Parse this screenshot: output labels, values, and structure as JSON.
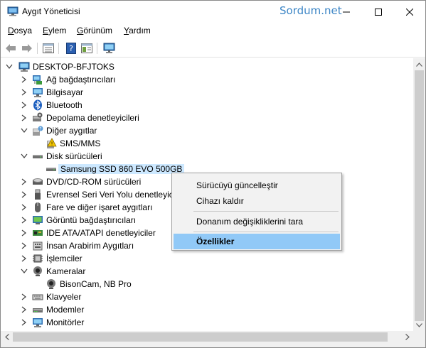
{
  "window": {
    "title": "Aygıt Yöneticisi",
    "watermark": "Sordum.net"
  },
  "menu": [
    {
      "label": "Dosya",
      "key": "D",
      "rest": "osya"
    },
    {
      "label": "Eylem",
      "key": "E",
      "rest": "ylem"
    },
    {
      "label": "Görünüm",
      "key": "G",
      "rest": "örünüm"
    },
    {
      "label": "Yardım",
      "key": "Y",
      "rest": "ardım"
    }
  ],
  "toolbar": {
    "icons": [
      "back-arrow-icon",
      "forward-arrow-icon",
      "properties-grid-icon",
      "help-icon",
      "details-panel-icon",
      "monitor-scan-icon"
    ]
  },
  "tree": {
    "root": "DESKTOP-BFJTOKS",
    "nodes": [
      {
        "label": "Ağ bağdaştırıcıları",
        "icon": "network-adapter-icon",
        "state": "collapsed",
        "level": 1
      },
      {
        "label": "Bilgisayar",
        "icon": "computer-icon",
        "state": "collapsed",
        "level": 1
      },
      {
        "label": "Bluetooth",
        "icon": "bluetooth-icon",
        "state": "collapsed",
        "level": 1
      },
      {
        "label": "Depolama denetleyicileri",
        "icon": "storage-controller-icon",
        "state": "collapsed",
        "level": 1
      },
      {
        "label": "Diğer aygıtlar",
        "icon": "other-devices-icon",
        "state": "expanded",
        "level": 1
      },
      {
        "label": "SMS/MMS",
        "icon": "unknown-device-icon",
        "state": "leaf",
        "level": 2
      },
      {
        "label": "Disk sürücüleri",
        "icon": "disk-drive-icon",
        "state": "expanded",
        "level": 1
      },
      {
        "label": "Samsung SSD 860 EVO 500GB",
        "icon": "disk-drive-icon",
        "state": "leaf",
        "level": 2,
        "selected": true
      },
      {
        "label": "DVD/CD-ROM sürücüleri",
        "icon": "dvd-drive-icon",
        "state": "collapsed",
        "level": 1
      },
      {
        "label": "Evrensel Seri Veri Yolu denetleyici",
        "icon": "usb-icon",
        "state": "collapsed",
        "level": 1
      },
      {
        "label": "Fare ve diğer işaret aygıtları",
        "icon": "mouse-icon",
        "state": "collapsed",
        "level": 1
      },
      {
        "label": "Görüntü bağdaştırıcıları",
        "icon": "display-adapter-icon",
        "state": "collapsed",
        "level": 1
      },
      {
        "label": "IDE ATA/ATAPI denetleyiciler",
        "icon": "ide-controller-icon",
        "state": "collapsed",
        "level": 1
      },
      {
        "label": "İnsan Arabirim Aygıtları",
        "icon": "hid-icon",
        "state": "collapsed",
        "level": 1
      },
      {
        "label": "İşlemciler",
        "icon": "processor-icon",
        "state": "collapsed",
        "level": 1
      },
      {
        "label": "Kameralar",
        "icon": "camera-icon",
        "state": "expanded",
        "level": 1
      },
      {
        "label": "BisonCam, NB Pro",
        "icon": "camera-icon",
        "state": "leaf",
        "level": 2
      },
      {
        "label": "Klavyeler",
        "icon": "keyboard-icon",
        "state": "collapsed",
        "level": 1
      },
      {
        "label": "Modemler",
        "icon": "modem-icon",
        "state": "collapsed",
        "level": 1
      },
      {
        "label": "Monitörler",
        "icon": "monitor-icon",
        "state": "collapsed",
        "level": 1
      }
    ]
  },
  "context_menu": {
    "items": [
      {
        "label": "Sürücüyü güncelleştir",
        "highlighted": false,
        "bold": false
      },
      {
        "label": "Cihazı kaldır",
        "highlighted": false,
        "bold": false
      },
      {
        "separator": true
      },
      {
        "label": "Donanım değişikliklerini tara",
        "highlighted": false,
        "bold": false
      },
      {
        "separator": true
      },
      {
        "label": "Özellikler",
        "highlighted": true,
        "bold": true
      }
    ]
  },
  "colors": {
    "watermark": "#3d86c6",
    "selection": "#cce8ff",
    "menu_highlight": "#91c9f7",
    "context_bg": "#f2f2f2"
  }
}
